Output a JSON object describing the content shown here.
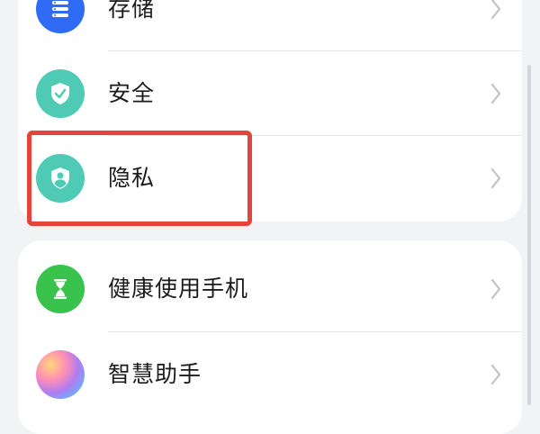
{
  "settings_list": {
    "group1": [
      {
        "label": "存储",
        "icon": "storage-icon",
        "color": "#2f6bf5"
      },
      {
        "label": "安全",
        "icon": "security-shield-icon",
        "color": "#4fcab4"
      },
      {
        "label": "隐私",
        "icon": "privacy-user-shield-icon",
        "color": "#4fcab4"
      }
    ],
    "group2": [
      {
        "label": "健康使用手机",
        "icon": "hourglass-icon",
        "color": "#39c24c"
      },
      {
        "label": "智慧助手",
        "icon": "smart-assistant-orb-icon",
        "color": "#b07cf0"
      }
    ]
  },
  "annotation": {
    "color": "#e5443a"
  }
}
